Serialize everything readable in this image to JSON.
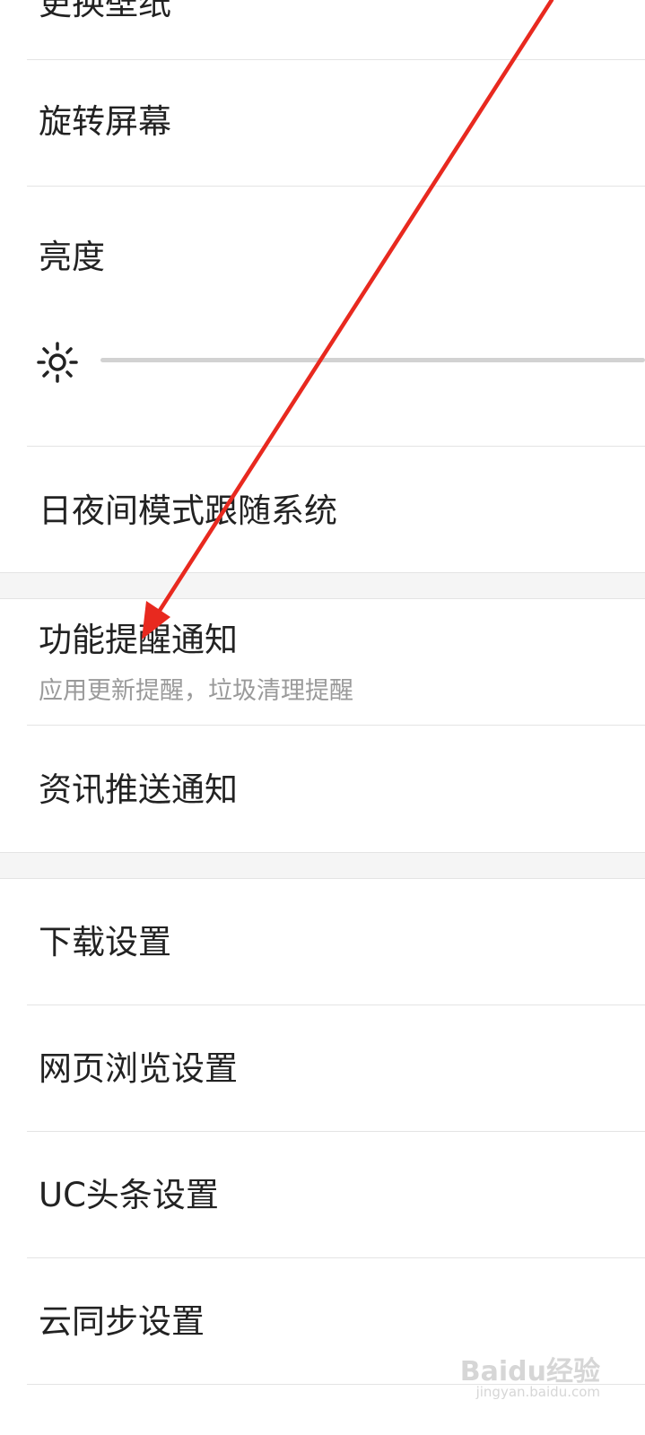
{
  "settings": {
    "wallpaper_label": "更换壁纸",
    "rotate_label": "旋转屏幕",
    "brightness_label": "亮度",
    "brightness_level": 0,
    "daynight_label": "日夜间模式跟随系统",
    "feature_notify_label": "功能提醒通知",
    "feature_notify_sub": "应用更新提醒，垃圾清理提醒",
    "news_push_label": "资讯推送通知",
    "download_label": "下载设置",
    "browse_label": "网页浏览设置",
    "uc_headline_label": "UC头条设置",
    "cloud_sync_label": "云同步设置"
  },
  "icons": {
    "brightness": "sun-icon",
    "annotation": "red-arrow"
  },
  "colors": {
    "arrow": "#e8291f",
    "divider": "#e4e4e4",
    "section_gap": "#f5f5f5"
  },
  "watermark": {
    "brand": "Baidu经验",
    "url": "jingyan.baidu.com"
  }
}
